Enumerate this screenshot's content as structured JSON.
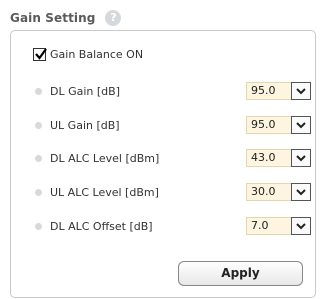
{
  "header": {
    "title": "Gain Setting",
    "help_icon": "?"
  },
  "gain_balance": {
    "label": "Gain Balance ON",
    "checked": true
  },
  "fields": [
    {
      "label": "DL Gain [dB]",
      "value": "95.0"
    },
    {
      "label": "UL Gain [dB]",
      "value": "95.0"
    },
    {
      "label": "DL ALC Level [dBm]",
      "value": "43.0"
    },
    {
      "label": "UL ALC Level [dBm]",
      "value": "30.0"
    },
    {
      "label": "DL ALC Offset [dB]",
      "value": "7.0"
    }
  ],
  "apply_label": "Apply",
  "colors": {
    "select_bg": "#fdf5df",
    "title": "#5a5a5a",
    "panel_border": "#c9c9c9"
  }
}
